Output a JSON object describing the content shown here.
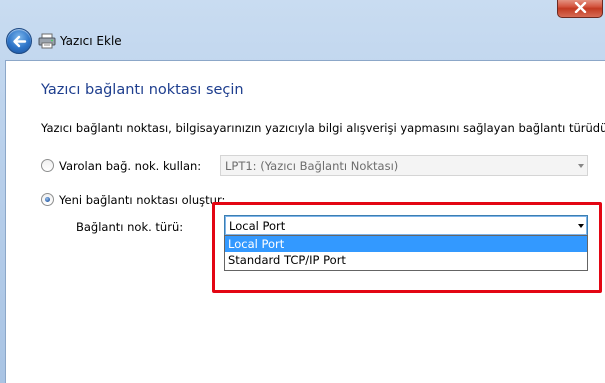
{
  "window": {
    "title": "Yazıcı Ekle"
  },
  "icons": {
    "close": "close-icon",
    "back": "back-arrow-icon",
    "printer": "printer-icon",
    "dropdown": "chevron-down-icon"
  },
  "colors": {
    "heading": "#1e3e8e",
    "selection": "#3399ff",
    "highlight_box": "#e30613",
    "close_button": "#c23a22"
  },
  "page": {
    "heading": "Yazıcı bağlantı noktası seçin",
    "description": "Yazıcı bağlantı noktası, bilgisayarınızın yazıcıyla bilgi alışverişi yapmasını sağlayan bağlantı türüdür."
  },
  "existing_port": {
    "label": "Varolan bağ. nok. kullan:",
    "selected": false,
    "value": "LPT1: (Yazıcı Bağlantı Noktası)"
  },
  "new_port": {
    "label": "Yeni bağlantı noktası oluştur:",
    "selected": true,
    "type_label": "Bağlantı nok. türü:",
    "value": "Local Port",
    "options": [
      "Local Port",
      "Standard TCP/IP Port"
    ]
  }
}
